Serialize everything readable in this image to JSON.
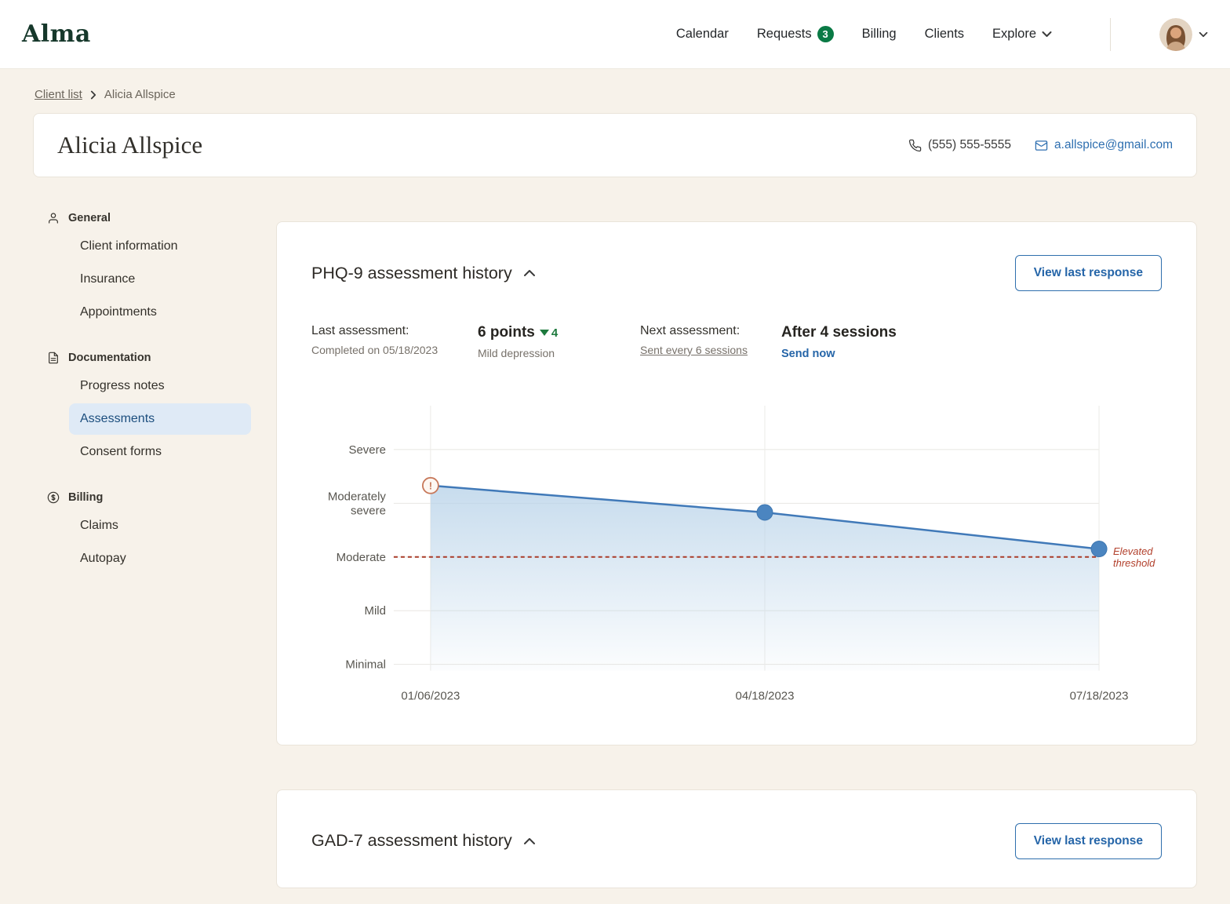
{
  "nav": {
    "logo": "Alma",
    "items": [
      {
        "label": "Calendar"
      },
      {
        "label": "Requests",
        "badge": "3"
      },
      {
        "label": "Billing"
      },
      {
        "label": "Clients"
      },
      {
        "label": "Explore"
      }
    ]
  },
  "breadcrumb": {
    "parent": "Client list",
    "current": "Alicia Allspice"
  },
  "client": {
    "name": "Alicia Allspice",
    "phone": "(555) 555-5555",
    "email": "a.allspice@gmail.com"
  },
  "sidebar": {
    "sections": [
      {
        "label": "General",
        "icon": "person-icon",
        "items": [
          {
            "label": "Client information"
          },
          {
            "label": "Insurance"
          },
          {
            "label": "Appointments"
          }
        ]
      },
      {
        "label": "Documentation",
        "icon": "document-icon",
        "items": [
          {
            "label": "Progress notes"
          },
          {
            "label": "Assessments",
            "active": true
          },
          {
            "label": "Consent forms"
          }
        ]
      },
      {
        "label": "Billing",
        "icon": "dollar-icon",
        "items": [
          {
            "label": "Claims"
          },
          {
            "label": "Autopay"
          }
        ]
      }
    ]
  },
  "phq9": {
    "title": "PHQ-9 assessment history",
    "view_last_response": "View last response",
    "last_assessment": {
      "label": "Last assessment:",
      "detail": "Completed on 05/18/2023",
      "points": "6 points",
      "delta": "4",
      "severity": "Mild depression"
    },
    "next_assessment": {
      "label": "Next assessment:",
      "schedule": "Sent every 6 sessions",
      "value": "After 4 sessions",
      "action": "Send now"
    }
  },
  "gad7": {
    "title": "GAD-7 assessment history",
    "view_last_response": "View last response"
  },
  "chart_data": {
    "type": "line",
    "title": "PHQ-9 assessment history",
    "x": [
      "01/06/2023",
      "04/18/2023",
      "07/18/2023"
    ],
    "y_ticks": [
      "Severe",
      "Moderately severe",
      "Moderate",
      "Mild",
      "Minimal"
    ],
    "y_scale_note": "severity bands, 0 = Minimal to 4 = Severe",
    "points": [
      {
        "date": "01/06/2023",
        "band_value": 3.33,
        "marker": "alert"
      },
      {
        "date": "04/18/2023",
        "band_value": 2.83,
        "marker": "dot"
      },
      {
        "date": "07/18/2023",
        "band_value": 2.15,
        "marker": "dot"
      }
    ],
    "threshold": {
      "band_value": 2.0,
      "label": "Elevated threshold"
    },
    "legend": "none",
    "grid": true,
    "colors": {
      "line": "#4079b8",
      "point": "#4b85c0",
      "area_top": "#b9d3e9",
      "threshold": "#a93b28",
      "alert": "#c7785a"
    }
  }
}
